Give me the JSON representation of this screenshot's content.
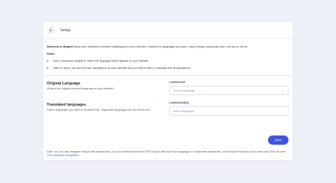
{
  "header": {
    "step_number": "1",
    "step_title": "Setup"
  },
  "intro": {
    "bold": "Welcome to Weglot!",
    "text": " Make your Salesforce website multilingual in a few minutes. Choose the languages you want, copy a simply Javascript code, and you're all set."
  },
  "steps": {
    "label": "Steps:",
    "items": [
      {
        "num": "1",
        "text": "Add a Javascript snippet to make the language button appear on your website."
      },
      {
        "num": "2",
        "text": "After it's done, you will see your translations on your website and you will be able to manually edit all translations."
      }
    ]
  },
  "original_language": {
    "title": "Original Language",
    "description": "What is the original (current) language of your website?",
    "field_label": "LANGUAGE",
    "placeholder": "Select a language"
  },
  "translated_languages": {
    "title": "Translated languages",
    "description": "Select languages you want to translate into. Supported languages can be found ",
    "link": "here",
    "link_suffix": ".",
    "field_label": "LANGUAGE(S)",
    "placeholder": "Select languages"
  },
  "next_label": "Next",
  "note": {
    "text": "Note: You can also integrate Weglot with subdomains. It is an excellent solution for SEO as you will have each language on a separate subdomain, but it requires that you can access your DNS records. ",
    "link": "Use subdomain integration"
  },
  "colors": {
    "accent": "#3f56e0",
    "background": "#eef0f7"
  }
}
